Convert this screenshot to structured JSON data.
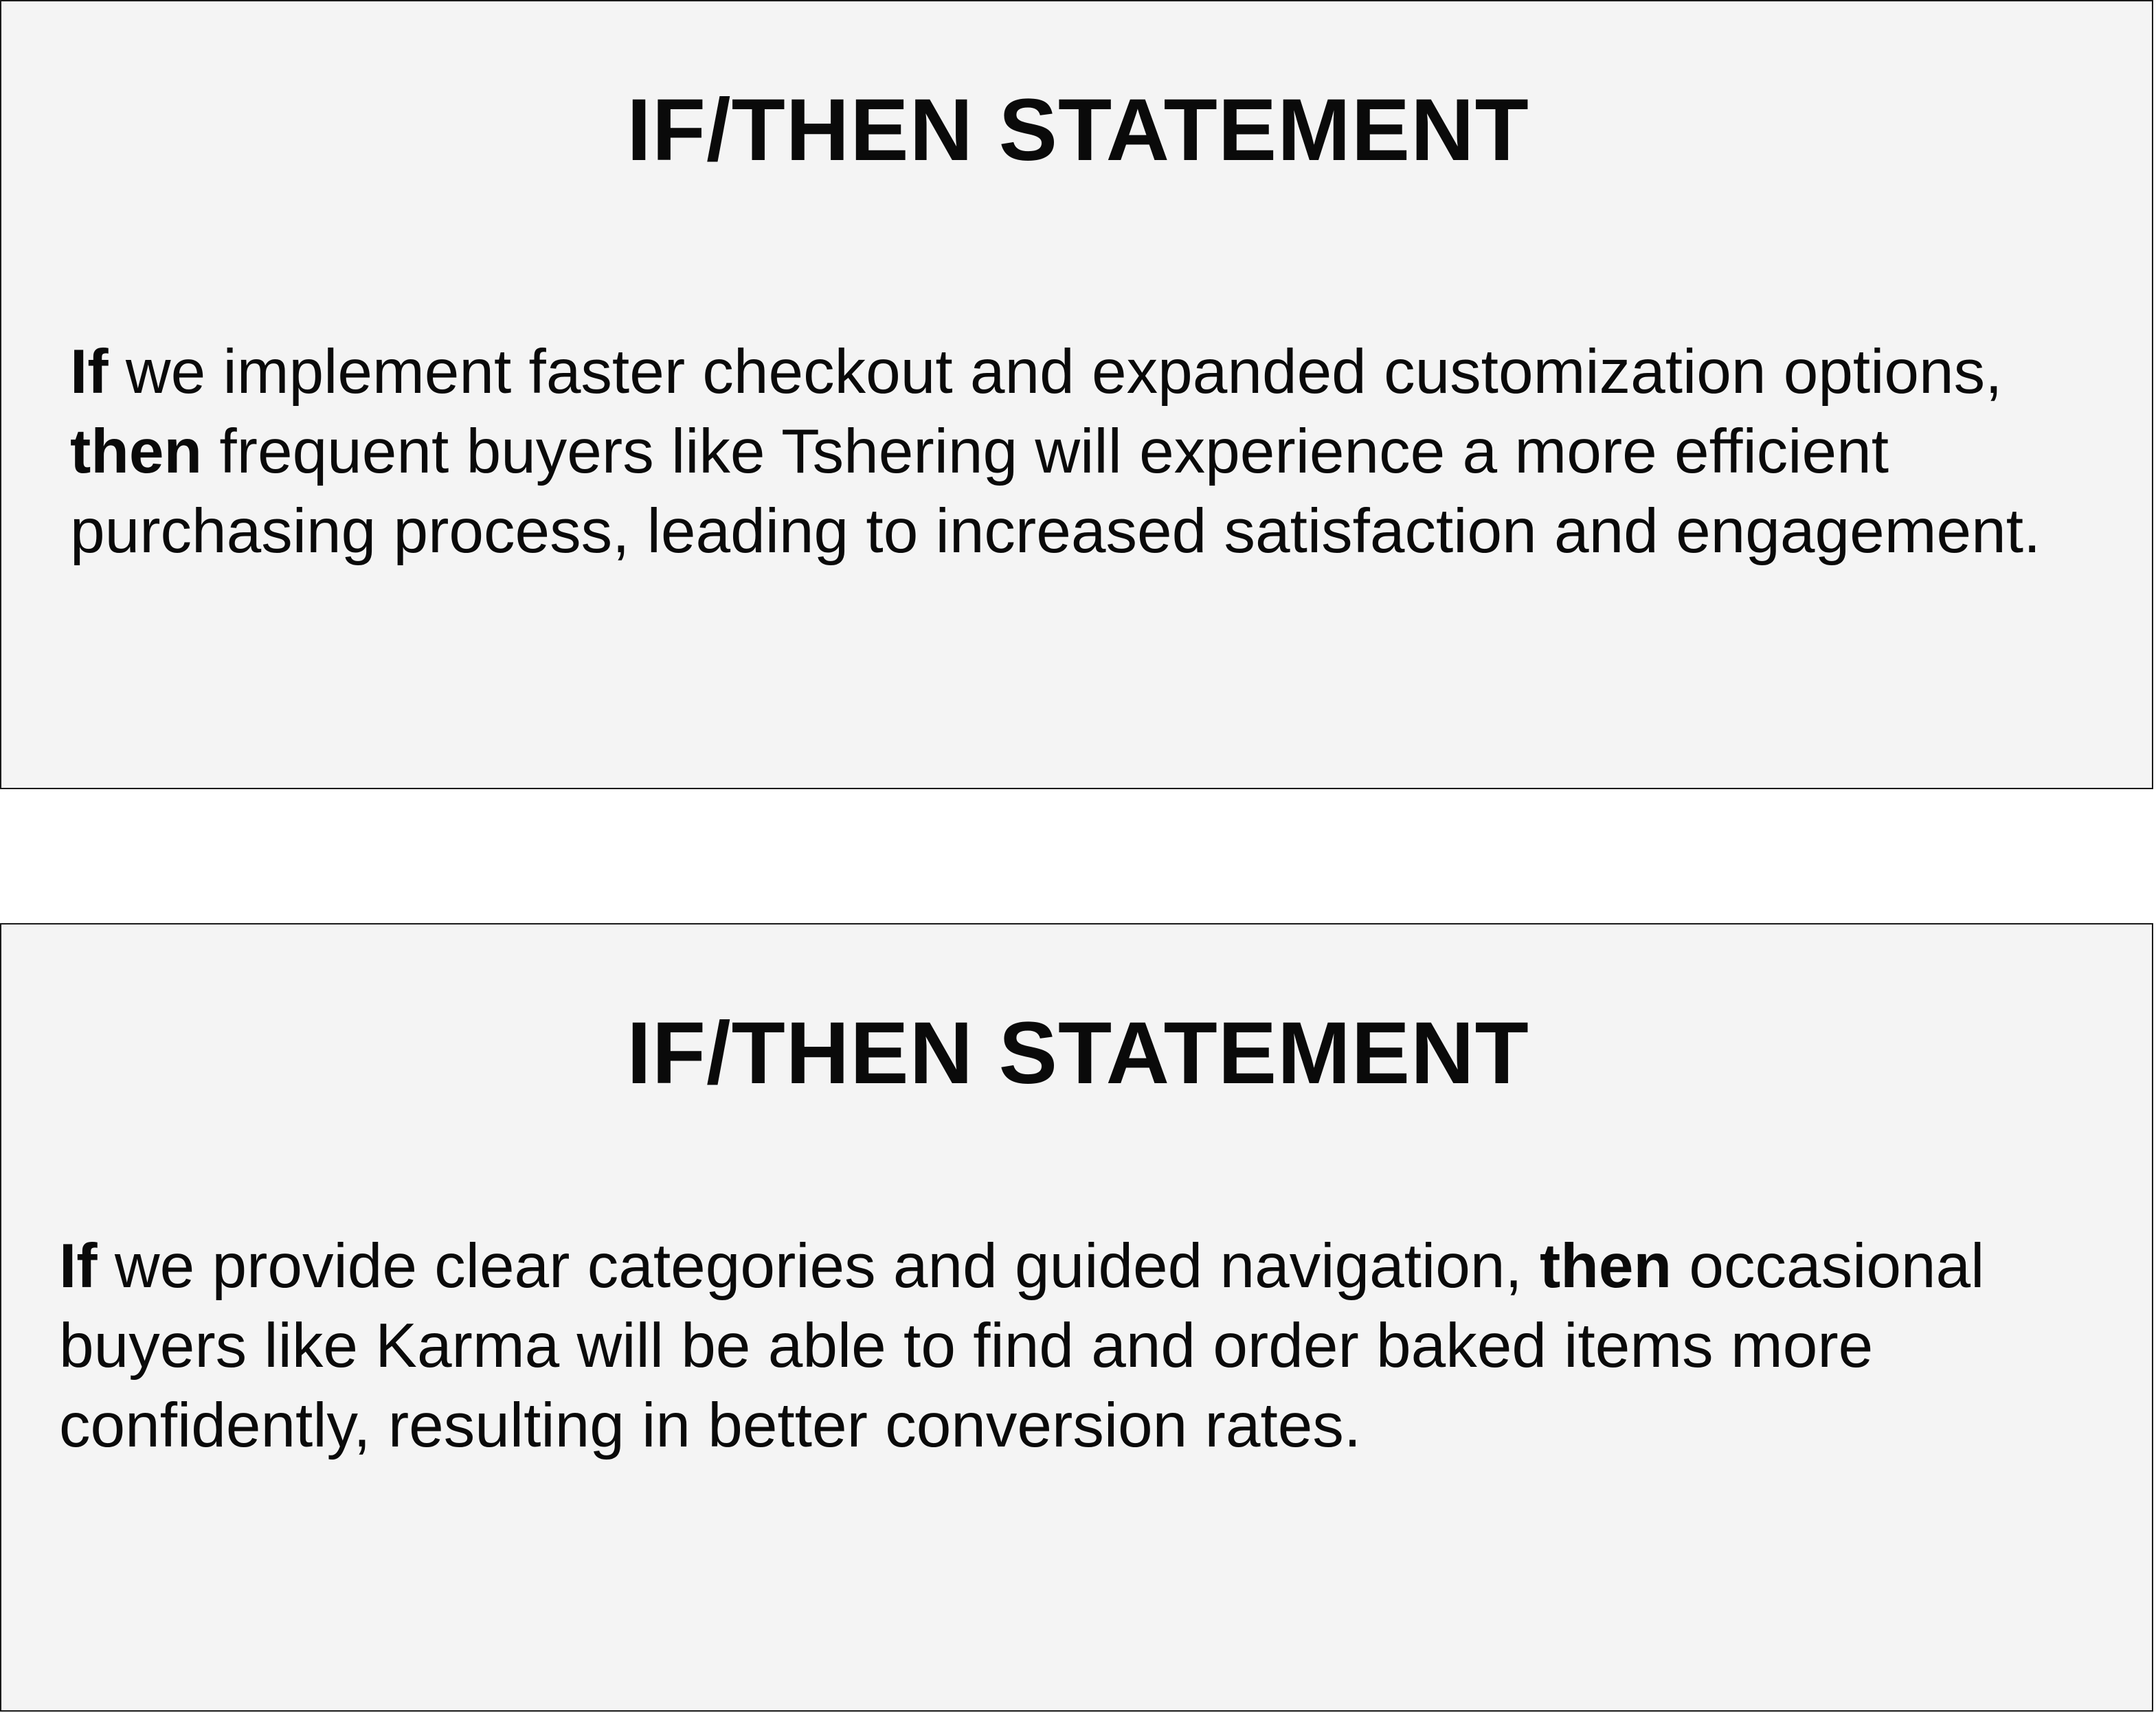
{
  "cards": [
    {
      "title": "IF/THEN STATEMENT",
      "if_word": "If",
      "condition": " we implement faster checkout and expanded customization options, ",
      "then_word": "then",
      "outcome": " frequent buyers like Tshering will experience a more efficient purchasing process, leading to increased satisfaction and engagement."
    },
    {
      "title": "IF/THEN STATEMENT",
      "if_word": "If",
      "condition": " we provide clear categories and guided navigation, ",
      "then_word": "then",
      "outcome": " occasional buyers like Karma will be able to find and order baked items more confidently, resulting in better conversion rates."
    }
  ]
}
